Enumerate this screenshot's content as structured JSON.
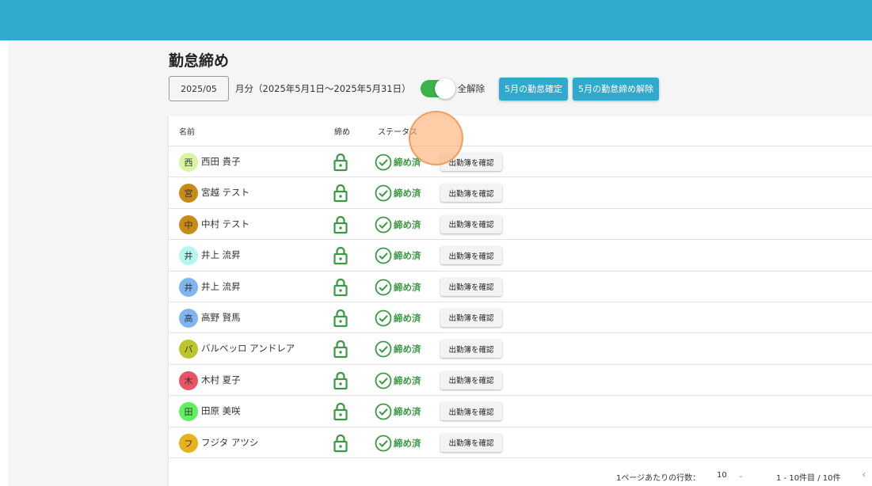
{
  "page": {
    "title": "勤怠締め"
  },
  "toolbar": {
    "month_value": "2025/05",
    "period_text": "月分（2025年5月1日〜2025年5月31日）",
    "toggle_label": "全解除",
    "toggle_on": true,
    "confirm_button": "5月の勤怠確定",
    "release_button": "5月の勤怠締め解除"
  },
  "colors": {
    "header": "#30a9cf",
    "primary_button": "#30a9cf",
    "toggle_on": "#3ab34a",
    "status_green": "#3a9a43"
  },
  "table": {
    "columns": {
      "name": "名前",
      "lock": "締め",
      "status": "ステータス"
    },
    "rows": [
      {
        "initial": "西",
        "name": "西田 貴子",
        "avatar_color": "#d8f5a2",
        "status": "締め済",
        "action": "出勤簿を確認",
        "lock_icon": "lock-icon"
      },
      {
        "initial": "宮",
        "name": "宮越 テスト",
        "avatar_color": "#c98a1a",
        "status": "締め済",
        "action": "出勤簿を確認",
        "lock_icon": "lock-icon"
      },
      {
        "initial": "中",
        "name": "中村 テスト",
        "avatar_color": "#c98a1a",
        "status": "締め済",
        "action": "出勤簿を確認",
        "lock_icon": "lock-icon"
      },
      {
        "initial": "井",
        "name": "井上 流昇",
        "avatar_color": "#b5f7ef",
        "status": "締め済",
        "action": "出勤簿を確認",
        "lock_icon": "lock-icon"
      },
      {
        "initial": "井",
        "name": "井上 流昇",
        "avatar_color": "#7fb6f2",
        "status": "締め済",
        "action": "出勤簿を確認",
        "lock_icon": "lock-icon"
      },
      {
        "initial": "高",
        "name": "高野 賢馬",
        "avatar_color": "#7fb6f2",
        "status": "締め済",
        "action": "出勤簿を確認",
        "lock_icon": "lock-icon"
      },
      {
        "initial": "バ",
        "name": "バルベッロ アンドレア",
        "avatar_color": "#bcc62c",
        "status": "締め済",
        "action": "出勤簿を確認",
        "lock_icon": "lock-icon"
      },
      {
        "initial": "木",
        "name": "木村 夏子",
        "avatar_color": "#e85466",
        "status": "締め済",
        "action": "出勤簿を確認",
        "lock_icon": "lock-icon"
      },
      {
        "initial": "田",
        "name": "田原 美咲",
        "avatar_color": "#5ff05f",
        "status": "締め済",
        "action": "出勤簿を確認",
        "lock_icon": "lock-icon"
      },
      {
        "initial": "フ",
        "name": "フジタ アツシ",
        "avatar_color": "#e8b01a",
        "status": "締め済",
        "action": "出勤簿を確認",
        "lock_icon": "lock-icon"
      }
    ]
  },
  "pagination": {
    "rows_per_page_label": "1ページあたりの行数：",
    "rows_per_page": "10",
    "range": "1 - 10件目 / 10件",
    "prev_icon": "chevron-left-icon"
  }
}
